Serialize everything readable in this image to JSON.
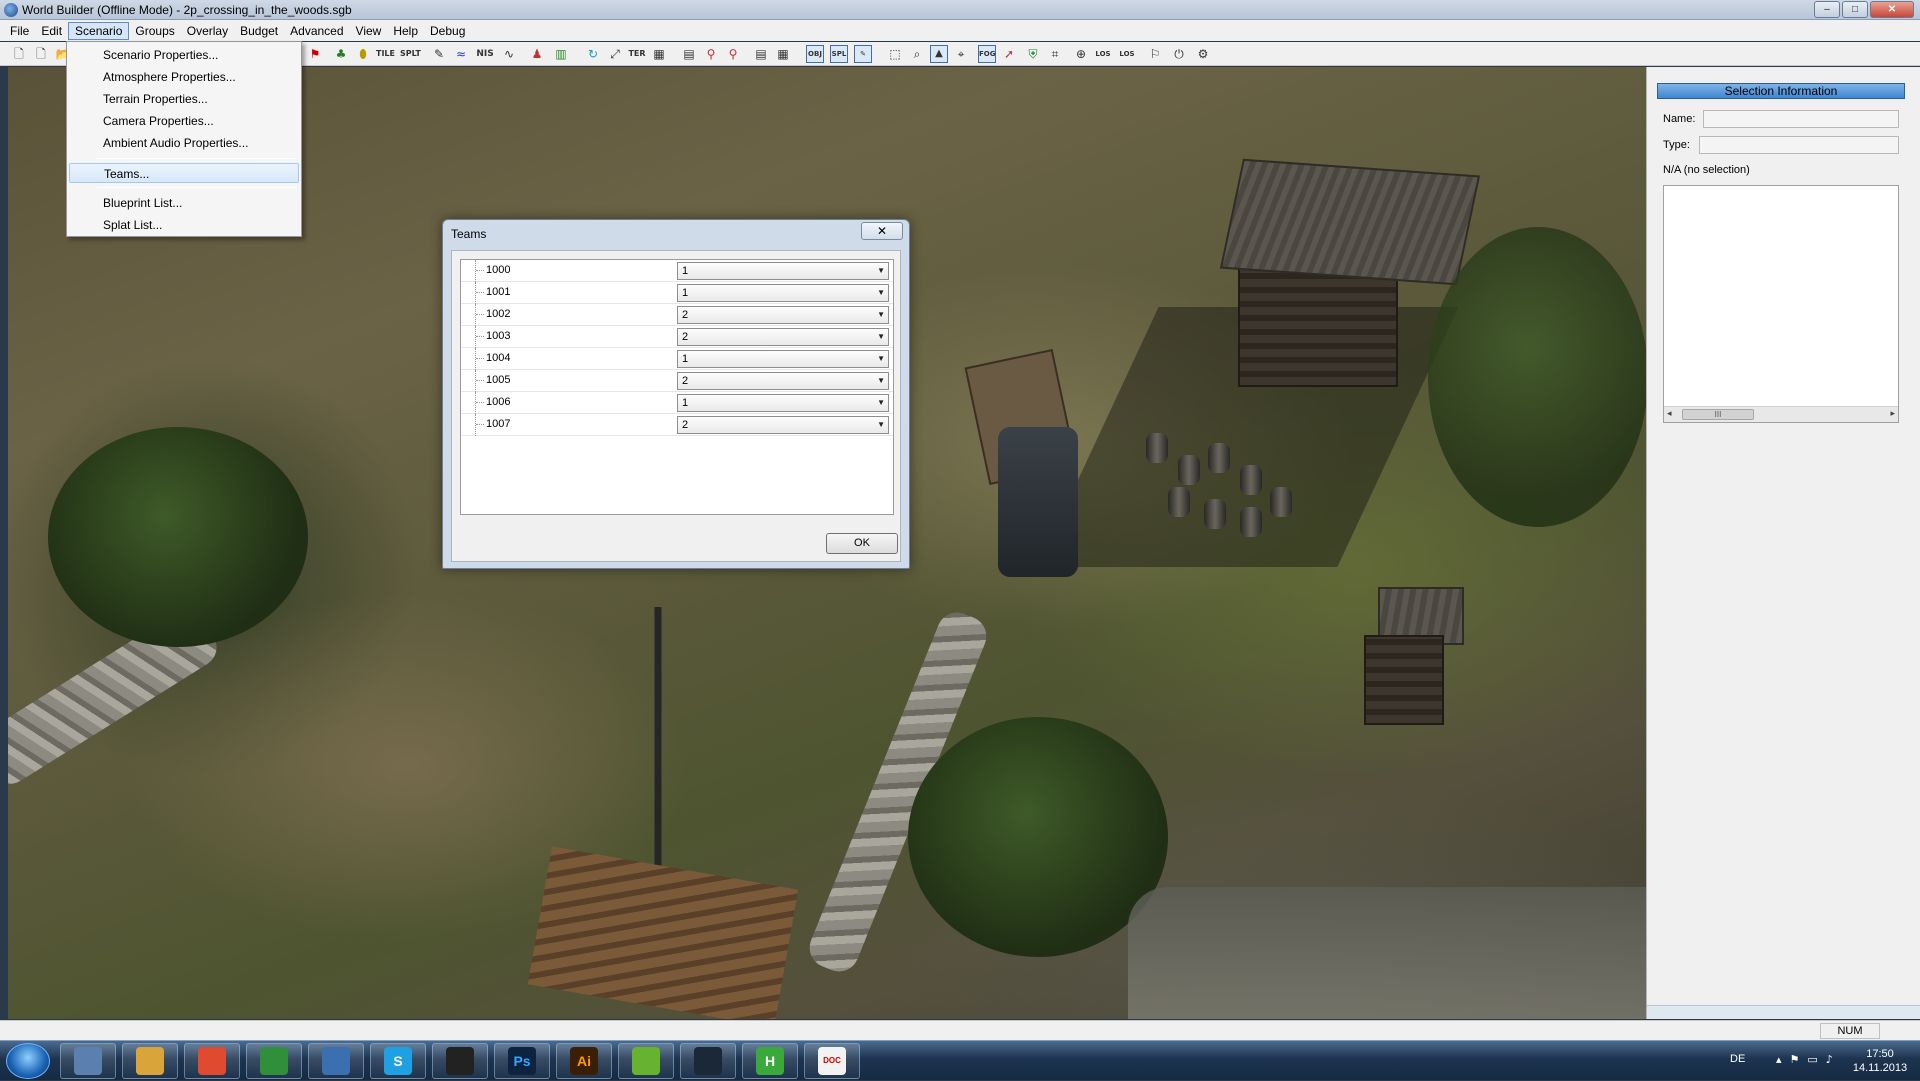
{
  "window": {
    "title": "World Builder (Offline Mode) - 2p_crossing_in_the_woods.sgb",
    "controls": {
      "minimize": "–",
      "maximize": "□",
      "close": "✕"
    }
  },
  "menubar": {
    "items": [
      "File",
      "Edit",
      "Scenario",
      "Groups",
      "Overlay",
      "Budget",
      "Advanced",
      "View",
      "Help",
      "Debug"
    ],
    "open_item": "Scenario"
  },
  "toolbar": {
    "text_buttons": [
      "TILE",
      "SPLT",
      "NIS",
      "TER",
      "OBJ",
      "SPL",
      "FOG",
      "LOS",
      "LOS"
    ]
  },
  "scenario_menu": {
    "items": [
      "Scenario Properties...",
      "Atmosphere Properties...",
      "Terrain Properties...",
      "Camera Properties...",
      "Ambient Audio Properties...",
      "Teams...",
      "Blueprint List...",
      "Splat List..."
    ],
    "highlighted": "Teams..."
  },
  "teams_dialog": {
    "title": "Teams",
    "close_label": "✕",
    "rows": [
      {
        "id": "1000",
        "team": "1"
      },
      {
        "id": "1001",
        "team": "1"
      },
      {
        "id": "1002",
        "team": "2"
      },
      {
        "id": "1003",
        "team": "2"
      },
      {
        "id": "1004",
        "team": "1"
      },
      {
        "id": "1005",
        "team": "2"
      },
      {
        "id": "1006",
        "team": "1"
      },
      {
        "id": "1007",
        "team": "2"
      }
    ],
    "ok_label": "OK"
  },
  "selection_panel": {
    "header": "Selection Information",
    "name_label": "Name:",
    "type_label": "Type:",
    "status": "N/A (no selection)",
    "scroll_thumb": "III"
  },
  "statusbar": {
    "num_indicator": "NUM"
  },
  "taskbar": {
    "apps": [
      {
        "name": "calculator-icon",
        "label": "",
        "color": "#5b7fae"
      },
      {
        "name": "explorer-icon",
        "label": "",
        "color": "#d9a53a"
      },
      {
        "name": "apps-grid-icon",
        "label": "",
        "color": "#e04a2f"
      },
      {
        "name": "chrome-icon",
        "label": "",
        "color": "#2f8f3a"
      },
      {
        "name": "thunderbird-icon",
        "label": "",
        "color": "#3a6fb0"
      },
      {
        "name": "skype-icon",
        "label": "S",
        "color": "#1fa0e3"
      },
      {
        "name": "obs-icon",
        "label": "",
        "color": "#222222"
      },
      {
        "name": "photoshop-icon",
        "label": "Ps",
        "color": "#0d2340"
      },
      {
        "name": "illustrator-icon",
        "label": "Ai",
        "color": "#3a1f05"
      },
      {
        "name": "spotify-icon",
        "label": "",
        "color": "#67b22f"
      },
      {
        "name": "steam-icon",
        "label": "",
        "color": "#1b2838"
      },
      {
        "name": "h-app-icon",
        "label": "H",
        "color": "#3aa83a"
      },
      {
        "name": "document-icon",
        "label": "DOC",
        "color": "#f2f2f2"
      }
    ],
    "language": "DE",
    "time": "17:50",
    "date": "14.11.2013"
  }
}
